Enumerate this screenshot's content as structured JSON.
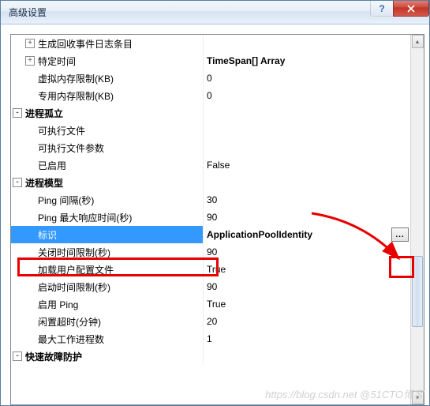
{
  "window": {
    "title": "高级设置",
    "help": "?",
    "close": "×"
  },
  "rows": [
    {
      "type": "item",
      "expander": "+",
      "indent": 1,
      "label": "生成回收事件日志条目",
      "value": ""
    },
    {
      "type": "item",
      "expander": "+",
      "indent": 1,
      "label": "特定时间",
      "value": "TimeSpan[] Array",
      "bold": true
    },
    {
      "type": "item",
      "indent": 1,
      "label": "虚拟内存限制(KB)",
      "value": "0"
    },
    {
      "type": "item",
      "indent": 1,
      "label": "专用内存限制(KB)",
      "value": "0"
    },
    {
      "type": "cat",
      "expander": "-",
      "indent": 0,
      "label": "进程孤立",
      "value": ""
    },
    {
      "type": "item",
      "indent": 1,
      "label": "可执行文件",
      "value": ""
    },
    {
      "type": "item",
      "indent": 1,
      "label": "可执行文件参数",
      "value": ""
    },
    {
      "type": "item",
      "indent": 1,
      "label": "已启用",
      "value": "False"
    },
    {
      "type": "cat",
      "expander": "-",
      "indent": 0,
      "label": "进程模型",
      "value": ""
    },
    {
      "type": "item",
      "indent": 1,
      "label": "Ping 间隔(秒)",
      "value": "30"
    },
    {
      "type": "item",
      "indent": 1,
      "label": "Ping 最大响应时间(秒)",
      "value": "90"
    },
    {
      "type": "item",
      "indent": 1,
      "label": "标识",
      "value": "ApplicationPoolIdentity",
      "selected": true,
      "browse": true,
      "bold": true
    },
    {
      "type": "item",
      "indent": 1,
      "label": "关闭时间限制(秒)",
      "value": "90"
    },
    {
      "type": "item",
      "indent": 1,
      "label": "加载用户配置文件",
      "value": "True"
    },
    {
      "type": "item",
      "indent": 1,
      "label": "启动时间限制(秒)",
      "value": "90"
    },
    {
      "type": "item",
      "indent": 1,
      "label": "启用 Ping",
      "value": "True"
    },
    {
      "type": "item",
      "indent": 1,
      "label": "闲置超时(分钟)",
      "value": "20"
    },
    {
      "type": "item",
      "indent": 1,
      "label": "最大工作进程数",
      "value": "1"
    },
    {
      "type": "cat",
      "expander": "-",
      "indent": 0,
      "label": "快速故障防护",
      "value": ""
    }
  ],
  "browse_label": "...",
  "watermark": "https://blog.csdn.net  @51CTO博客"
}
